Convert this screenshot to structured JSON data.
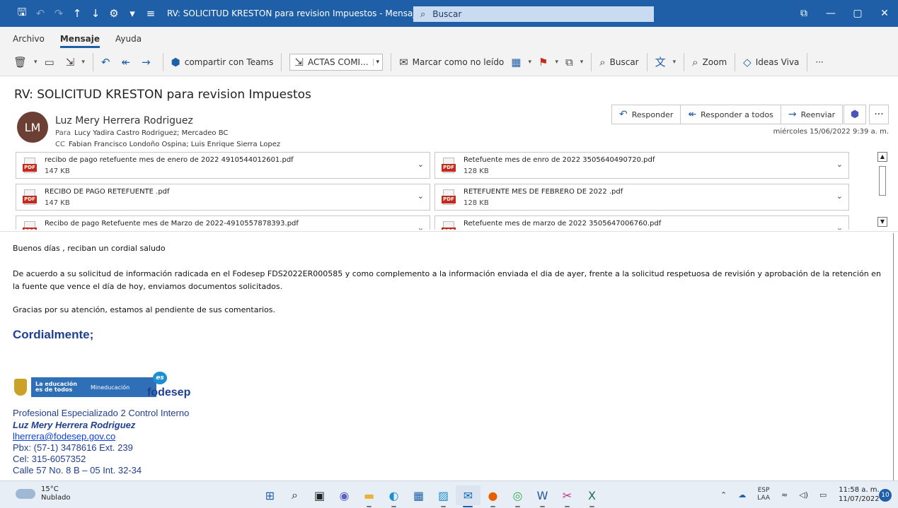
{
  "window": {
    "title": "RV: SOLICITUD KRESTON para revision Impuestos  -  Mensaje (HTML)",
    "search_placeholder": "Buscar"
  },
  "menu": [
    "Archivo",
    "Mensaje",
    "Ayuda"
  ],
  "ribbon": {
    "share_teams": "compartir con Teams",
    "quickstep": "ACTAS COMI...",
    "mark_unread": "Marcar como no leído",
    "search": "Buscar",
    "zoom": "Zoom",
    "ideas": "Ideas Viva",
    "more": "···"
  },
  "message": {
    "subject": "RV: SOLICITUD KRESTON para revision Impuestos",
    "avatar_initials": "LM",
    "sender": "Luz Mery Herrera Rodriguez",
    "to_label": "Para",
    "to": "Lucy Yadira Castro Rodriguez; Mercadeo BC",
    "cc_label": "CC",
    "cc": "Fabian Francisco Londoño Ospina; Luis Enrique Sierra Lopez",
    "date": "miércoles 15/06/2022 9:39 a. m.",
    "actions": {
      "reply": "Responder",
      "reply_all": "Responder a todos",
      "forward": "Reenviar"
    }
  },
  "attachments": [
    {
      "name": "recibo de pago retefuente mes de enero de 2022 4910544012601.pdf",
      "size": "147 KB"
    },
    {
      "name": "Retefuente mes de enro de 2022  3505640490720.pdf",
      "size": "128 KB"
    },
    {
      "name": "RECIBO DE PAGO RETEFUENTE .pdf",
      "size": "147 KB"
    },
    {
      "name": "RETEFUENTE MES DE FEBRERO DE 2022 .pdf",
      "size": "128 KB"
    },
    {
      "name": "Recibo de pago Retefuente mes de Marzo de 2022-4910557878393.pdf",
      "size": ""
    },
    {
      "name": "Retefuente mes de marzo de 2022 3505647006760.pdf",
      "size": ""
    }
  ],
  "pdf_label": "PDF",
  "body": {
    "greeting": "Buenos días , reciban un cordial saludo",
    "paragraph": "De acuerdo a su solicitud de información radicada en el Fodesep FDS2022ER000585 y como complemento a la información enviada el dia de ayer, frente a la solicitud respetuosa de revisión y aprobación de la retención en la fuente que vence el día de hoy, enviamos documentos solicitados.",
    "thanks": "Gracias por su atención, estamos al pendiente de sus comentarios.",
    "closing": "Cordialmente;"
  },
  "logos": {
    "band_line1": "La educación",
    "band_line2": "es de todos",
    "band_ministry": "Mineducación",
    "es_mark": "es",
    "brand": "fodesep"
  },
  "signature": {
    "role": "Profesional Especializado 2 Control Interno",
    "name": "Luz Mery Herrera Rodriguez",
    "email": "lherrera@fodesep.gov.co",
    "pbx": "Pbx: (57-1) 3478616  Ext. 239",
    "cel": "Cel: 315-6057352",
    "address": "Calle 57 No. 8 B – 05 Int. 32-34"
  },
  "taskbar": {
    "temp": "15°C",
    "weather": "Nublado",
    "lang1": "ESP",
    "lang2": "LAA",
    "time": "11:58 a. m.",
    "date": "11/07/2022",
    "notifications": "10"
  }
}
